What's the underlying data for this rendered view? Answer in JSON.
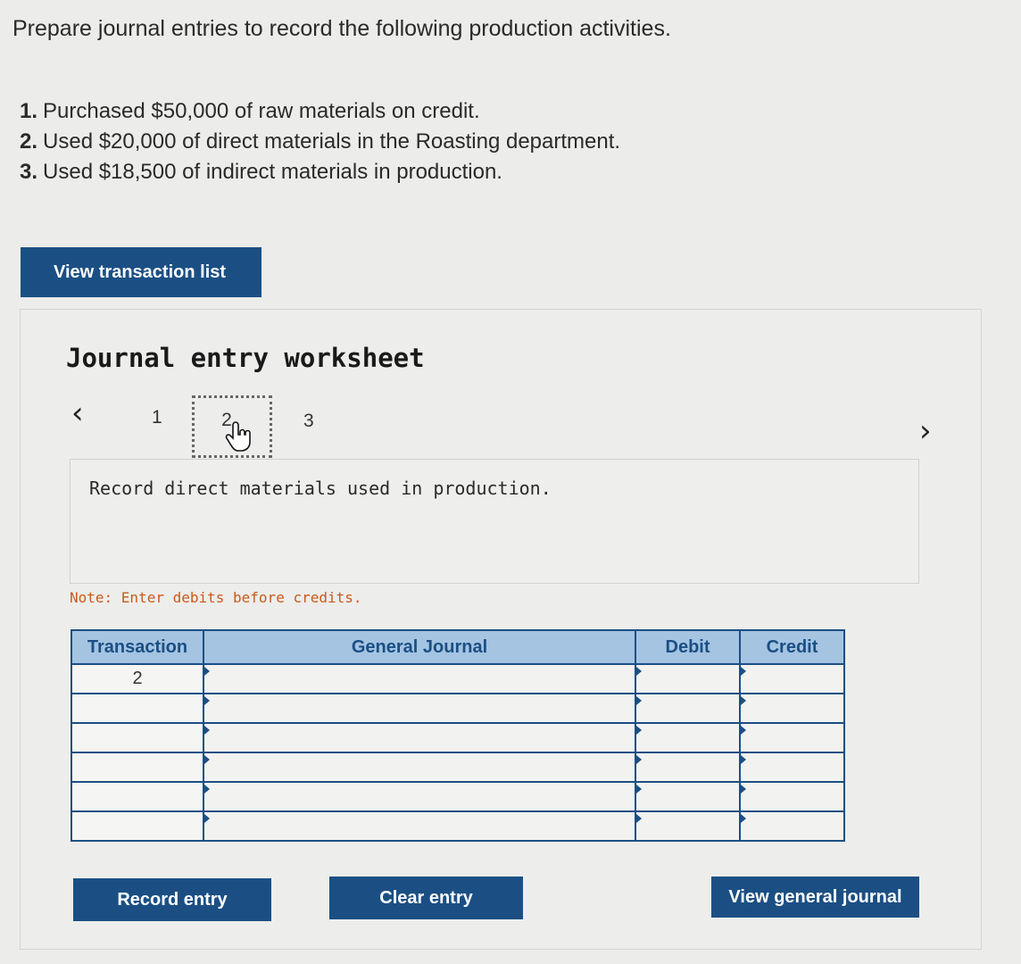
{
  "prompt": "Prepare journal entries to record the following production activities.",
  "tasks": [
    {
      "num": "1.",
      "text": "Purchased $50,000 of raw materials on credit."
    },
    {
      "num": "2.",
      "text": "Used $20,000 of direct materials in the Roasting department."
    },
    {
      "num": "3.",
      "text": "Used $18,500 of indirect materials in production."
    }
  ],
  "view_transaction_list_label": "View transaction list",
  "worksheet": {
    "title": "Journal entry worksheet",
    "prev_icon": "chevron-left-icon",
    "next_icon": "chevron-right-icon",
    "pages": [
      "1",
      "2",
      "3"
    ],
    "current_page": "2",
    "instruction": "Record direct materials used in production.",
    "note": "Note: Enter debits before credits."
  },
  "table": {
    "headers": [
      "Transaction",
      "General Journal",
      "Debit",
      "Credit"
    ],
    "rows": [
      {
        "transaction": "2",
        "account": "",
        "debit": "",
        "credit": ""
      },
      {
        "transaction": "",
        "account": "",
        "debit": "",
        "credit": ""
      },
      {
        "transaction": "",
        "account": "",
        "debit": "",
        "credit": ""
      },
      {
        "transaction": "",
        "account": "",
        "debit": "",
        "credit": ""
      },
      {
        "transaction": "",
        "account": "",
        "debit": "",
        "credit": ""
      },
      {
        "transaction": "",
        "account": "",
        "debit": "",
        "credit": ""
      }
    ]
  },
  "buttons": {
    "record": "Record entry",
    "clear": "Clear entry",
    "general_journal": "View general journal"
  },
  "colors": {
    "primary": "#1b4f84",
    "header_bg": "#a4c4e2",
    "note": "#c95a1c"
  }
}
